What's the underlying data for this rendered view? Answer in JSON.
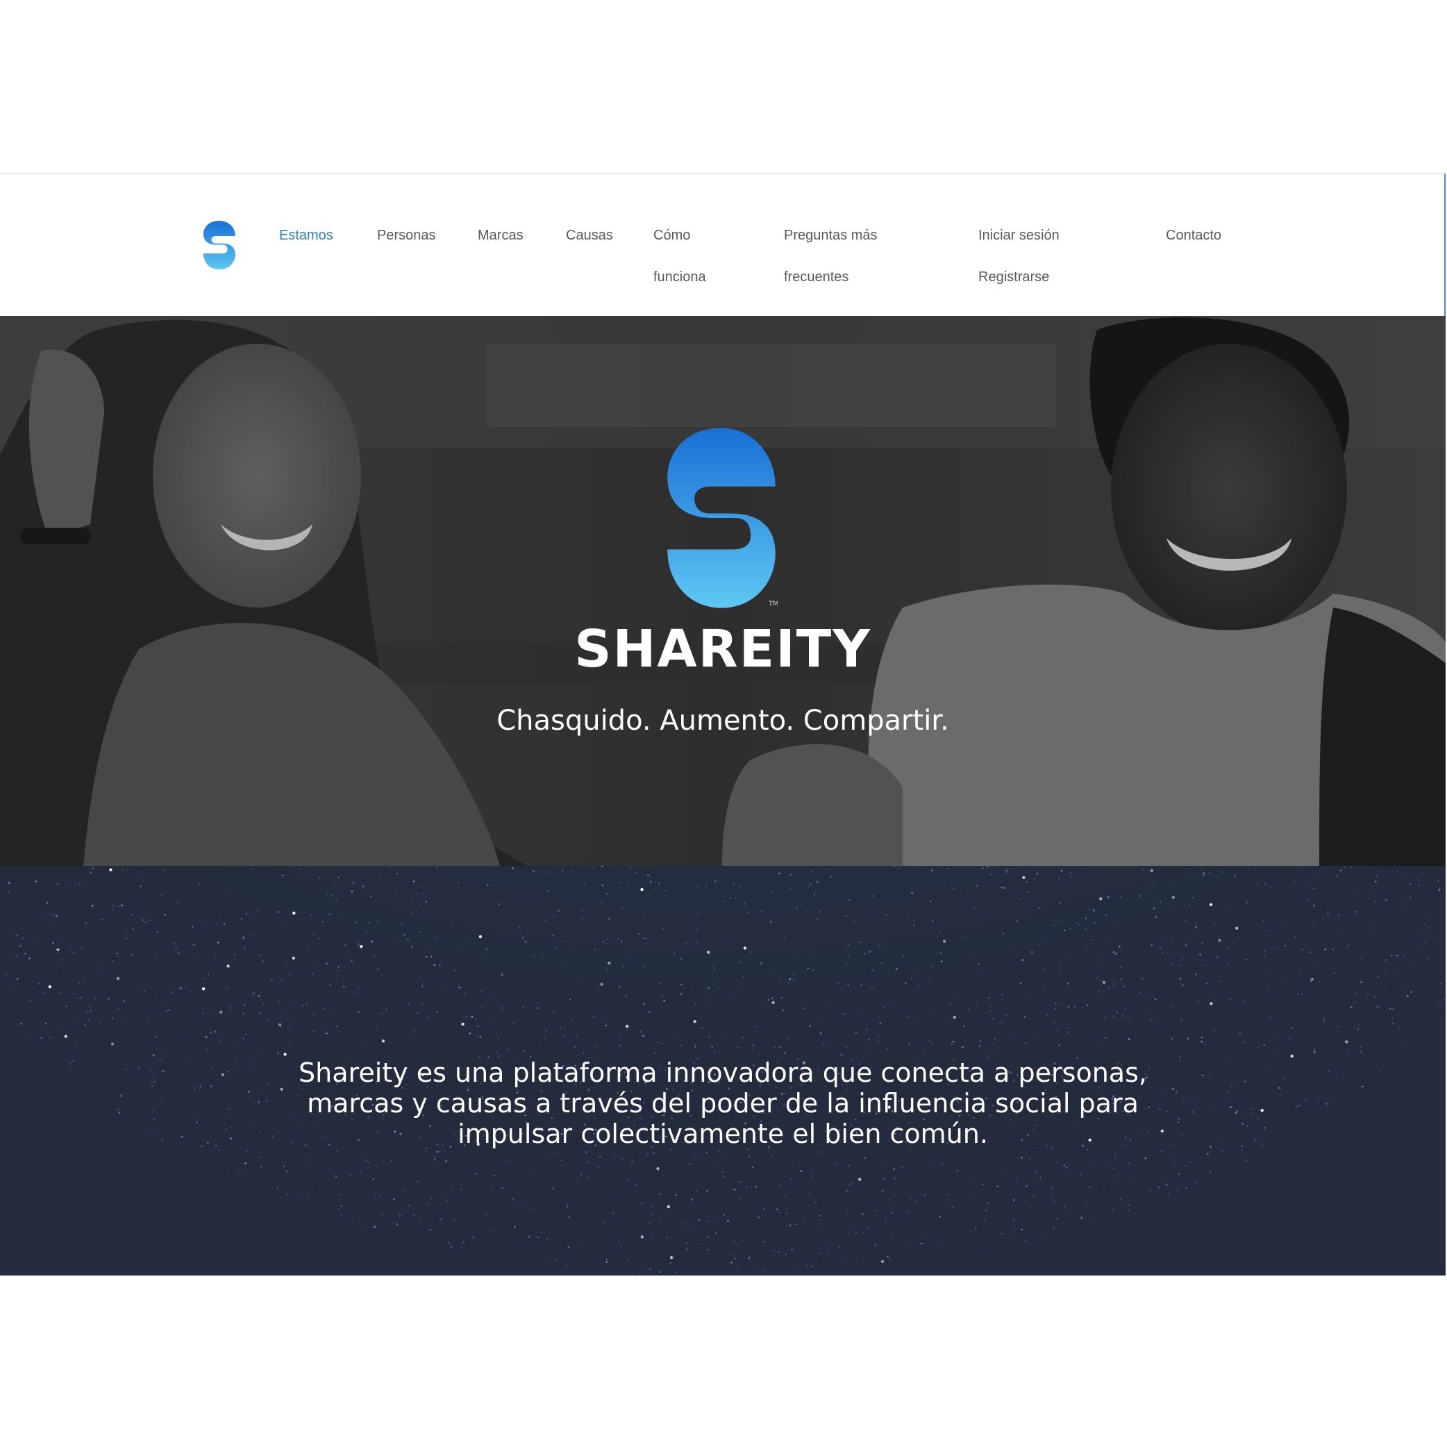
{
  "nav": {
    "logo_icon": "shareity-s-logo-icon",
    "items": [
      {
        "label": "Estamos",
        "active": true
      },
      {
        "label": "Personas"
      },
      {
        "label": "Marcas"
      },
      {
        "label": "Causas"
      },
      {
        "label_line1": "Cómo",
        "label_line2": "funciona"
      },
      {
        "label_line1": "Preguntas más",
        "label_line2": "frecuentes"
      },
      {
        "label": "Iniciar sesión"
      },
      {
        "label": "Registrarse"
      },
      {
        "label": "Contacto"
      }
    ],
    "active_color": "#2f7fc1",
    "text_color": "#555a60"
  },
  "hero": {
    "logo_icon": "shareity-s-logo-icon",
    "brand_name": "SHAREITY",
    "tagline": "Chasquido. Aumento. Compartir."
  },
  "about": {
    "description": "Shareity es una plataforma innovadora que conecta a personas, marcas y causas a través del poder de la influencia social para impulsar colectivamente el bien común.",
    "background_color": "#232b3c"
  },
  "colors": {
    "brand_gradient_top": "#1a6fd6",
    "brand_gradient_bottom": "#5ec8f2"
  }
}
